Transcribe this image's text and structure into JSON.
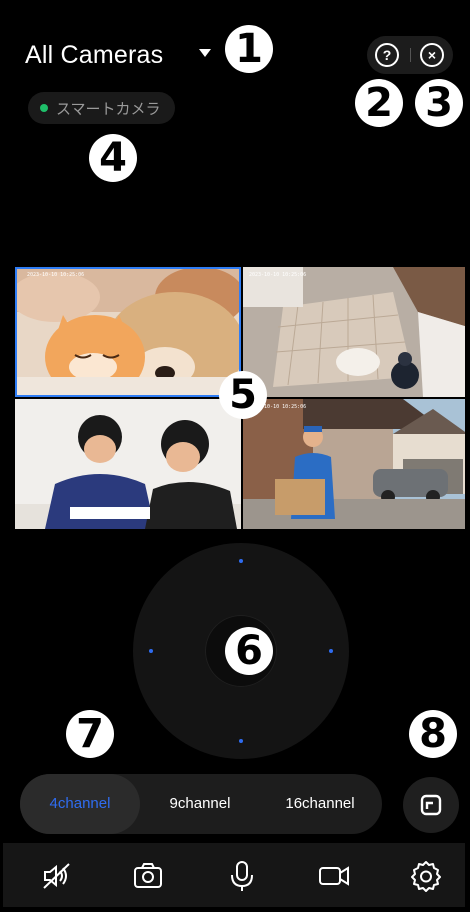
{
  "header": {
    "title": "All Cameras",
    "help_icon": "question-circle-icon",
    "close_icon": "close-circle-icon"
  },
  "device_chip": {
    "label": "スマートカメラ",
    "status_color": "#1fbf6a"
  },
  "annotations": [
    "1",
    "2",
    "3",
    "4",
    "5",
    "6",
    "7",
    "8"
  ],
  "grid": {
    "selected_color": "#2f7df5",
    "tiles": [
      {
        "name": "kitten-puppy-feed"
      },
      {
        "name": "hallway-overhead-feed"
      },
      {
        "name": "children-studying-feed"
      },
      {
        "name": "delivery-porch-feed"
      }
    ]
  },
  "channels": {
    "items": [
      "4channel",
      "9channel",
      "16channel"
    ],
    "selected": "4channel",
    "accent": "#2f6cf0"
  },
  "toolbar": {
    "icons": [
      "speaker-muted-icon",
      "camera-snapshot-icon",
      "microphone-icon",
      "video-record-icon",
      "settings-gear-icon"
    ]
  }
}
